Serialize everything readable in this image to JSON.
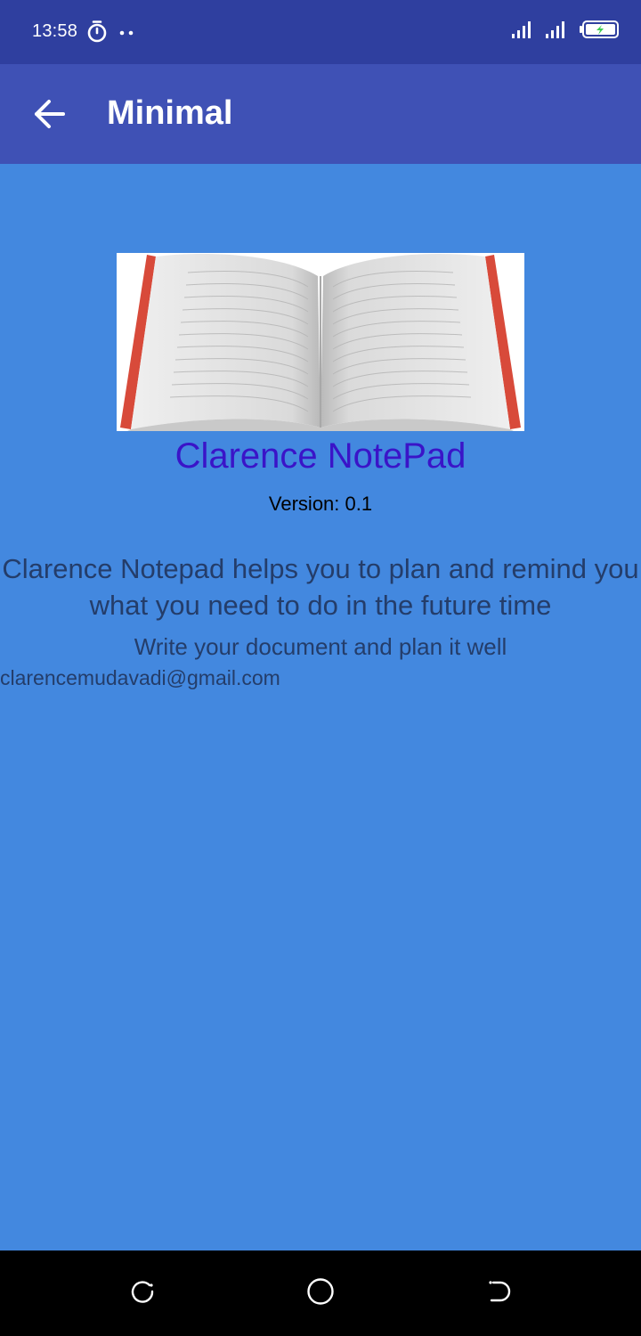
{
  "status_bar": {
    "time": "13:58",
    "icons": [
      "timer-icon",
      "more-dots-icon",
      "signal-icon",
      "signal-icon",
      "battery-charging-icon"
    ]
  },
  "app_bar": {
    "title": "Minimal",
    "back_icon": "arrow-back-icon"
  },
  "content": {
    "image": "open-book-image",
    "app_name": "Clarence NotePad",
    "version": "Version: 0.1",
    "description": "Clarence Notepad helps you to plan and remind you what you need to do in the future time",
    "tagline": "Write your document and plan it well",
    "email": "clarencemudavadi@gmail.com"
  },
  "nav_bar": {
    "buttons": [
      "recent-apps",
      "home",
      "back"
    ]
  },
  "colors": {
    "status_bar": "#2F3F9F",
    "app_bar": "#3F51B5",
    "background": "#4388DF",
    "app_name": "#3A14C8",
    "body_text": "#243D6A"
  }
}
